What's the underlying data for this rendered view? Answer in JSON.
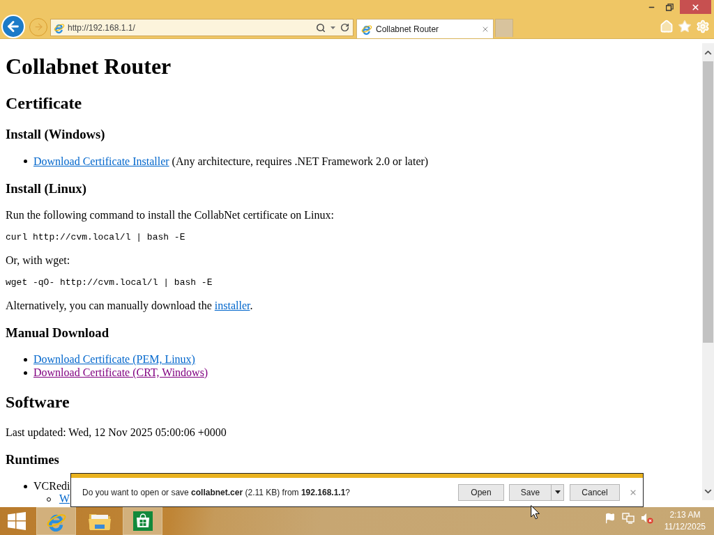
{
  "browser": {
    "address": "http://192.168.1.1/",
    "tabs": [
      {
        "title": "Collabnet Router",
        "selected": true
      }
    ]
  },
  "page": {
    "blocks": [
      {
        "kind": "heading1",
        "text": "Collabnet Router"
      },
      {
        "kind": "heading2",
        "text": "Certificate"
      },
      {
        "kind": "heading3",
        "text": "Install (Windows)"
      },
      {
        "kind": "list",
        "items": [
          {
            "segments": [
              {
                "kind": "link",
                "text": "Download Certificate Installer",
                "visited": false
              },
              {
                "kind": "text",
                "text": " (Any architecture, requires .NET Framework 2.0 or later)"
              }
            ]
          }
        ]
      },
      {
        "kind": "heading3",
        "text": "Install (Linux)"
      },
      {
        "kind": "paragraph",
        "segments": [
          {
            "kind": "text",
            "text": "Run the following command to install the CollabNet certificate on Linux:"
          }
        ]
      },
      {
        "kind": "code",
        "text": "curl http://cvm.local/l | bash -E"
      },
      {
        "kind": "paragraph",
        "segments": [
          {
            "kind": "text",
            "text": "Or, with wget:"
          }
        ]
      },
      {
        "kind": "code",
        "text": "wget -qO- http://cvm.local/l | bash -E"
      },
      {
        "kind": "paragraph",
        "segments": [
          {
            "kind": "text",
            "text": "Alternatively, you can manually download the "
          },
          {
            "kind": "link",
            "text": "installer",
            "visited": false
          },
          {
            "kind": "text",
            "text": "."
          }
        ]
      },
      {
        "kind": "heading3",
        "text": "Manual Download"
      },
      {
        "kind": "list",
        "items": [
          {
            "segments": [
              {
                "kind": "link",
                "text": "Download Certificate (PEM, Linux)",
                "visited": false
              }
            ]
          },
          {
            "segments": [
              {
                "kind": "link",
                "text": "Download Certificate (CRT, Windows)",
                "visited": true
              }
            ]
          }
        ]
      },
      {
        "kind": "heading2",
        "text": "Software"
      },
      {
        "kind": "paragraph",
        "segments": [
          {
            "kind": "text",
            "text": "Last updated: Wed, 12 Nov 2025 05:00:06 +0000"
          }
        ]
      },
      {
        "kind": "heading3",
        "text": "Runtimes"
      },
      {
        "kind": "list",
        "items": [
          {
            "segments": [
              {
                "kind": "text",
                "text": "VCRedi"
              }
            ],
            "children": [
              {
                "segments": [
                  {
                    "kind": "link",
                    "text": "W",
                    "visited": false
                  }
                ]
              }
            ]
          }
        ]
      }
    ]
  },
  "download_bar": {
    "message": "Do you want to open or save **collabnet.cer** (2.11 KB) from **192.168.1.1**?",
    "buttons": [
      {
        "label": "Open",
        "kind": "plain"
      },
      {
        "label": "Save",
        "kind": "split"
      },
      {
        "label": "Cancel",
        "kind": "plain"
      }
    ]
  },
  "taskbar": {
    "apps": [
      {
        "kind": "browser",
        "running": true
      },
      {
        "kind": "files",
        "running": false
      },
      {
        "kind": "store",
        "running": true
      }
    ],
    "clock": {
      "time": "2:13 AM",
      "date": "11/12/2025"
    }
  }
}
